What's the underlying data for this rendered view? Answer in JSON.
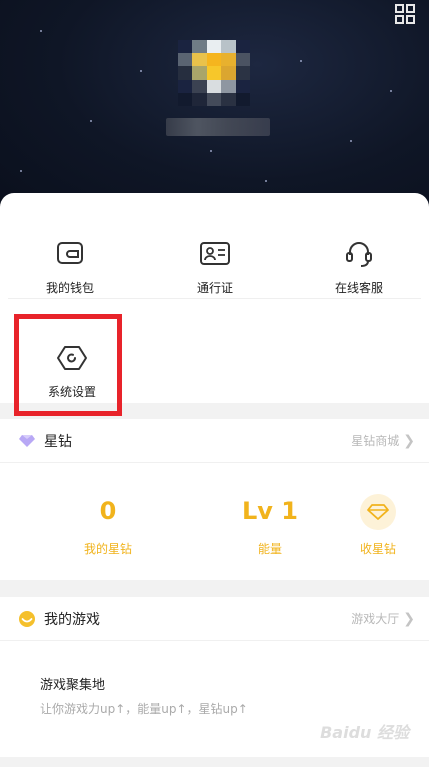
{
  "profile": {
    "qr_icon": "qr-code-icon"
  },
  "tools": {
    "wallet": {
      "label": "我的钱包",
      "icon": "wallet-icon"
    },
    "pass": {
      "label": "通行证",
      "icon": "id-card-icon"
    },
    "service": {
      "label": "在线客服",
      "icon": "headset-icon"
    },
    "settings": {
      "label": "系统设置",
      "icon": "hex-gear-icon"
    }
  },
  "star_diamond": {
    "title": "星钻",
    "link": "星钻商城",
    "stats": [
      {
        "value": "0",
        "label": "我的星钻"
      },
      {
        "value": "Lv 1",
        "label": "能量"
      },
      {
        "label": "收星钻"
      }
    ]
  },
  "my_games": {
    "title": "我的游戏",
    "link": "游戏大厅",
    "card_title": "游戏聚集地",
    "card_desc": "让你游戏力up↑，能量up↑，星钻up↑"
  },
  "colors": {
    "accent": "#f1b31c",
    "highlight": "#e8232a"
  },
  "watermark": "Baidu 经验"
}
